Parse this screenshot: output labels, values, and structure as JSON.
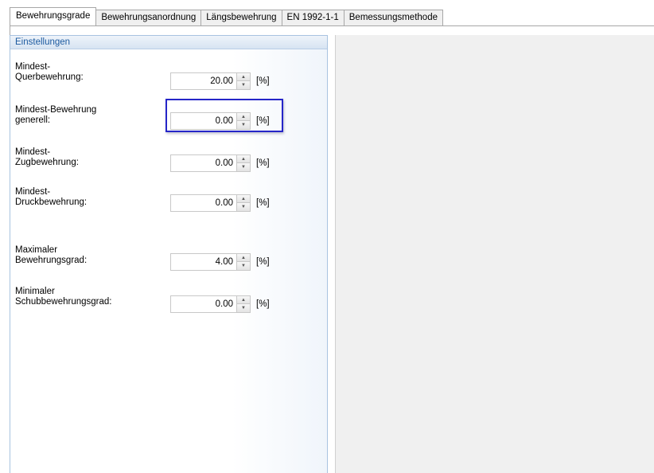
{
  "tabs": [
    {
      "label": "Bewehrungsgrade",
      "active": true
    },
    {
      "label": "Bewehrungsanordnung",
      "active": false
    },
    {
      "label": "Längsbewehrung",
      "active": false
    },
    {
      "label": "EN 1992-1-1",
      "active": false
    },
    {
      "label": "Bemessungsmethode",
      "active": false
    }
  ],
  "panel": {
    "header": "Einstellungen",
    "fields": [
      {
        "label_line1": "Mindest-",
        "label_line2": "Querbewehrung:",
        "value": "20.00",
        "unit": "[%]",
        "focused": true
      },
      {
        "label_line1": "Mindest-Bewehrung",
        "label_line2": "generell:",
        "value": "0.00",
        "unit": "[%]"
      },
      {
        "label_line1": "Mindest-",
        "label_line2": "Zugbewehrung:",
        "value": "0.00",
        "unit": "[%]"
      },
      {
        "label_line1": "Mindest-",
        "label_line2": "Druckbewehrung:",
        "value": "0.00",
        "unit": "[%]"
      },
      {
        "label_line1": "Maximaler",
        "label_line2": "Bewehrungsgrad:",
        "value": "4.00",
        "unit": "[%]"
      },
      {
        "label_line1": "Minimaler",
        "label_line2": "Schubbewehrungsgrad:",
        "value": "0.00",
        "unit": "[%]"
      }
    ]
  },
  "colors": {
    "panel_header_text": "#1c5aa0",
    "focus_ring": "#2525c8",
    "right_area_bg": "#f0f0f0"
  }
}
